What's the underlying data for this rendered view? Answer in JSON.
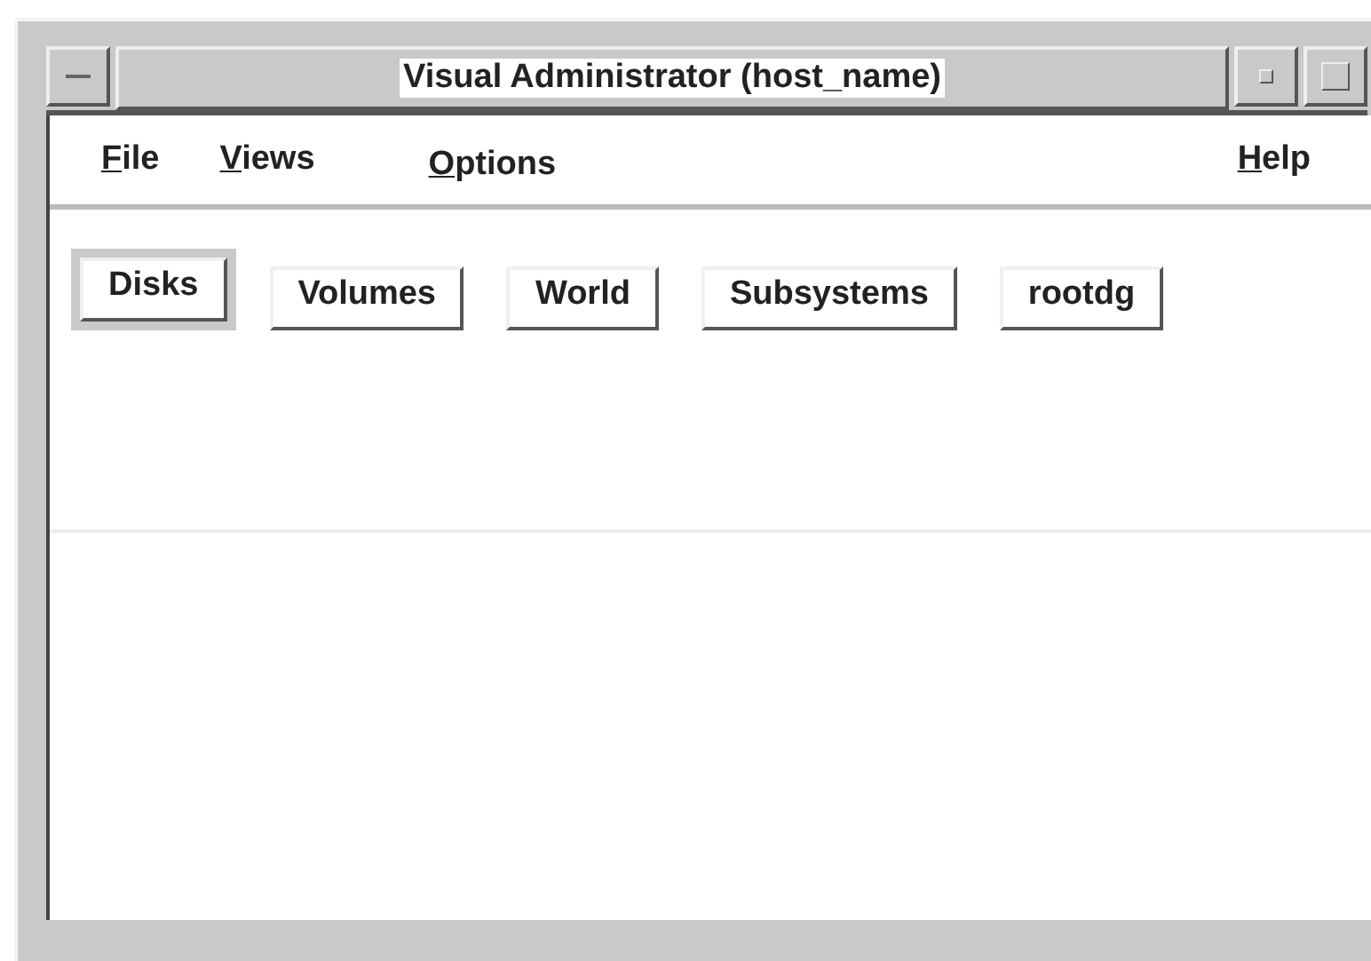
{
  "window": {
    "title": "Visual Administrator (host_name)"
  },
  "menu": [
    {
      "label": "File"
    },
    {
      "label": "Views"
    },
    {
      "label": "Options"
    },
    {
      "label": "Help"
    }
  ],
  "views": [
    {
      "label": "Disks",
      "selected": true
    },
    {
      "label": "Volumes",
      "selected": false
    },
    {
      "label": "World",
      "selected": false
    },
    {
      "label": "Subsystems",
      "selected": false
    },
    {
      "label": "rootdg",
      "selected": false
    }
  ]
}
